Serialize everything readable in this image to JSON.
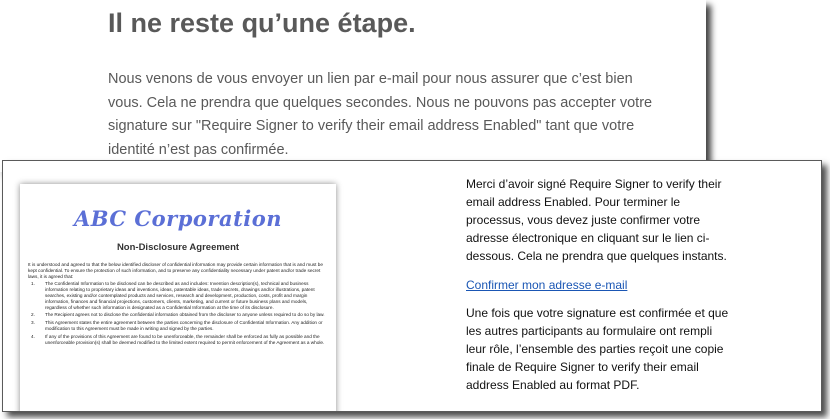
{
  "top": {
    "title": "Il ne reste qu’une étape.",
    "body": "Nous venons de vous envoyer un lien par e-mail pour nous assurer que c’est bien vous. Cela ne prendra que quelques secondes. Nous ne pouvons pas accepter votre signature sur \"Require Signer to verify their email address Enabled\" tant que votre identité n’est pas confirmée."
  },
  "document": {
    "logo": "ABC Corporation",
    "heading": "Non-Disclosure Agreement",
    "intro": "It is understood and agreed to that the below identified discloser of confidential information may provide certain information that is and must be kept confidential. To ensure the protection of such information, and to preserve any confidentiality necessary under patent and/or trade secret laws, it is agreed that:",
    "clauses": [
      {
        "num": "1.",
        "text": "The Confidential Information to be disclosed can be described as and includes: Invention description(s), technical and business information relating to proprietary ideas and inventions, ideas, patentable ideas, trade secrets, drawings and/or illustrations, patent searches, existing and/or contemplated products and services, research and development, production, costs, profit and margin information, finances and financial projections, customers, clients, marketing, and current or future business plans and models, regardless of whether such information is designated as a Confidential Information at the time of its disclosure."
      },
      {
        "num": "2.",
        "text": "The Recipient agrees not to disclose the confidential information obtained from the discloser to anyone unless required to do so by law."
      },
      {
        "num": "3.",
        "text": "This Agreement states the entire agreement between the parties concerning the disclosure of Confidential Information. Any addition or modification to this Agreement must be made in writing and signed by the parties."
      },
      {
        "num": "4.",
        "text": "If any of the provisions of this Agreement are found to be unenforceable, the remainder shall be enforced as fully as possible and the unenforceable provision(s) shall be deemed modified to the limited extent required to permit enforcement of the Agreement as a whole."
      }
    ]
  },
  "email": {
    "para1": "Merci d’avoir signé Require Signer to verify their email address Enabled. Pour terminer le processus, vous devez juste confirmer votre adresse électronique en cliquant sur le lien ci-dessous. Cela ne prendra que quelques instants.",
    "link": "Confirmer mon adresse e-mail",
    "para2": "Une fois que votre signature est confirmée et que les autres participants au formulaire ont rempli leur rôle, l’ensemble des parties reçoit une copie finale de Require Signer to verify their email address Enabled au format PDF."
  }
}
